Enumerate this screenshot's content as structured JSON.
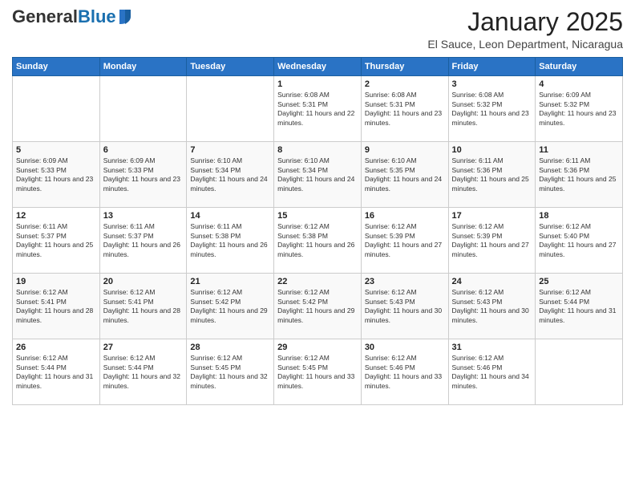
{
  "logo": {
    "general": "General",
    "blue": "Blue"
  },
  "header": {
    "month": "January 2025",
    "location": "El Sauce, Leon Department, Nicaragua"
  },
  "weekdays": [
    "Sunday",
    "Monday",
    "Tuesday",
    "Wednesday",
    "Thursday",
    "Friday",
    "Saturday"
  ],
  "weeks": [
    [
      {
        "day": "",
        "info": ""
      },
      {
        "day": "",
        "info": ""
      },
      {
        "day": "",
        "info": ""
      },
      {
        "day": "1",
        "info": "Sunrise: 6:08 AM\nSunset: 5:31 PM\nDaylight: 11 hours and 22 minutes."
      },
      {
        "day": "2",
        "info": "Sunrise: 6:08 AM\nSunset: 5:31 PM\nDaylight: 11 hours and 23 minutes."
      },
      {
        "day": "3",
        "info": "Sunrise: 6:08 AM\nSunset: 5:32 PM\nDaylight: 11 hours and 23 minutes."
      },
      {
        "day": "4",
        "info": "Sunrise: 6:09 AM\nSunset: 5:32 PM\nDaylight: 11 hours and 23 minutes."
      }
    ],
    [
      {
        "day": "5",
        "info": "Sunrise: 6:09 AM\nSunset: 5:33 PM\nDaylight: 11 hours and 23 minutes."
      },
      {
        "day": "6",
        "info": "Sunrise: 6:09 AM\nSunset: 5:33 PM\nDaylight: 11 hours and 23 minutes."
      },
      {
        "day": "7",
        "info": "Sunrise: 6:10 AM\nSunset: 5:34 PM\nDaylight: 11 hours and 24 minutes."
      },
      {
        "day": "8",
        "info": "Sunrise: 6:10 AM\nSunset: 5:34 PM\nDaylight: 11 hours and 24 minutes."
      },
      {
        "day": "9",
        "info": "Sunrise: 6:10 AM\nSunset: 5:35 PM\nDaylight: 11 hours and 24 minutes."
      },
      {
        "day": "10",
        "info": "Sunrise: 6:11 AM\nSunset: 5:36 PM\nDaylight: 11 hours and 25 minutes."
      },
      {
        "day": "11",
        "info": "Sunrise: 6:11 AM\nSunset: 5:36 PM\nDaylight: 11 hours and 25 minutes."
      }
    ],
    [
      {
        "day": "12",
        "info": "Sunrise: 6:11 AM\nSunset: 5:37 PM\nDaylight: 11 hours and 25 minutes."
      },
      {
        "day": "13",
        "info": "Sunrise: 6:11 AM\nSunset: 5:37 PM\nDaylight: 11 hours and 26 minutes."
      },
      {
        "day": "14",
        "info": "Sunrise: 6:11 AM\nSunset: 5:38 PM\nDaylight: 11 hours and 26 minutes."
      },
      {
        "day": "15",
        "info": "Sunrise: 6:12 AM\nSunset: 5:38 PM\nDaylight: 11 hours and 26 minutes."
      },
      {
        "day": "16",
        "info": "Sunrise: 6:12 AM\nSunset: 5:39 PM\nDaylight: 11 hours and 27 minutes."
      },
      {
        "day": "17",
        "info": "Sunrise: 6:12 AM\nSunset: 5:39 PM\nDaylight: 11 hours and 27 minutes."
      },
      {
        "day": "18",
        "info": "Sunrise: 6:12 AM\nSunset: 5:40 PM\nDaylight: 11 hours and 27 minutes."
      }
    ],
    [
      {
        "day": "19",
        "info": "Sunrise: 6:12 AM\nSunset: 5:41 PM\nDaylight: 11 hours and 28 minutes."
      },
      {
        "day": "20",
        "info": "Sunrise: 6:12 AM\nSunset: 5:41 PM\nDaylight: 11 hours and 28 minutes."
      },
      {
        "day": "21",
        "info": "Sunrise: 6:12 AM\nSunset: 5:42 PM\nDaylight: 11 hours and 29 minutes."
      },
      {
        "day": "22",
        "info": "Sunrise: 6:12 AM\nSunset: 5:42 PM\nDaylight: 11 hours and 29 minutes."
      },
      {
        "day": "23",
        "info": "Sunrise: 6:12 AM\nSunset: 5:43 PM\nDaylight: 11 hours and 30 minutes."
      },
      {
        "day": "24",
        "info": "Sunrise: 6:12 AM\nSunset: 5:43 PM\nDaylight: 11 hours and 30 minutes."
      },
      {
        "day": "25",
        "info": "Sunrise: 6:12 AM\nSunset: 5:44 PM\nDaylight: 11 hours and 31 minutes."
      }
    ],
    [
      {
        "day": "26",
        "info": "Sunrise: 6:12 AM\nSunset: 5:44 PM\nDaylight: 11 hours and 31 minutes."
      },
      {
        "day": "27",
        "info": "Sunrise: 6:12 AM\nSunset: 5:44 PM\nDaylight: 11 hours and 32 minutes."
      },
      {
        "day": "28",
        "info": "Sunrise: 6:12 AM\nSunset: 5:45 PM\nDaylight: 11 hours and 32 minutes."
      },
      {
        "day": "29",
        "info": "Sunrise: 6:12 AM\nSunset: 5:45 PM\nDaylight: 11 hours and 33 minutes."
      },
      {
        "day": "30",
        "info": "Sunrise: 6:12 AM\nSunset: 5:46 PM\nDaylight: 11 hours and 33 minutes."
      },
      {
        "day": "31",
        "info": "Sunrise: 6:12 AM\nSunset: 5:46 PM\nDaylight: 11 hours and 34 minutes."
      },
      {
        "day": "",
        "info": ""
      }
    ]
  ]
}
